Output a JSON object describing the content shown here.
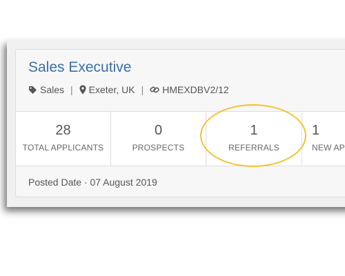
{
  "job": {
    "title": "Sales Executive",
    "department": "Sales",
    "location": "Exeter, UK",
    "reference": "HMEXDBV2/12",
    "separator": "|"
  },
  "icons": {
    "department": "tag-icon",
    "location": "map-marker-icon",
    "reference": "link-icon"
  },
  "stats": [
    {
      "value": "28",
      "label": "TOTAL APPLICANTS"
    },
    {
      "value": "0",
      "label": "PROSPECTS"
    },
    {
      "value": "1",
      "label": "REFERRALS"
    },
    {
      "value": "1",
      "label": "NEW AP"
    }
  ],
  "footer": {
    "posted": "Posted Date · 07 August 2019"
  },
  "colors": {
    "title": "#3a6fa7",
    "highlight": "#f2c230"
  }
}
